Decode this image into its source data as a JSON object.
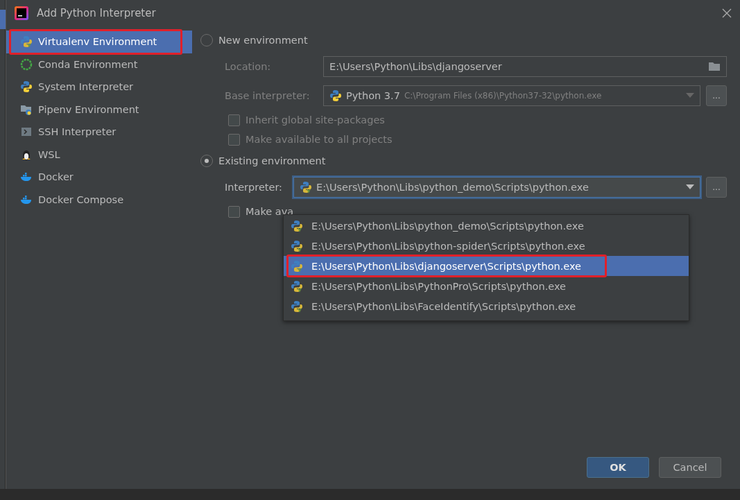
{
  "window": {
    "title": "Add Python Interpreter"
  },
  "sidebar": {
    "items": [
      {
        "label": "Virtualenv Environment",
        "kind": "virtualenv",
        "selected": true,
        "highlighted": true
      },
      {
        "label": "Conda Environment",
        "kind": "conda",
        "selected": false,
        "highlighted": false
      },
      {
        "label": "System Interpreter",
        "kind": "python",
        "selected": false,
        "highlighted": false
      },
      {
        "label": "Pipenv Environment",
        "kind": "pipenv",
        "selected": false,
        "highlighted": false
      },
      {
        "label": "SSH Interpreter",
        "kind": "ssh",
        "selected": false,
        "highlighted": false
      },
      {
        "label": "WSL",
        "kind": "wsl",
        "selected": false,
        "highlighted": false
      },
      {
        "label": "Docker",
        "kind": "docker",
        "selected": false,
        "highlighted": false
      },
      {
        "label": "Docker Compose",
        "kind": "docker",
        "selected": false,
        "highlighted": false
      }
    ]
  },
  "new_environment": {
    "label": "New environment",
    "selected": false,
    "location": {
      "label": "Location:",
      "value": "E:\\Users\\Python\\Libs\\djangoserver"
    },
    "base_interpreter": {
      "label": "Base interpreter:",
      "name": "Python 3.7",
      "path": "C:\\Program Files (x86)\\Python37-32\\python.exe",
      "more": "..."
    },
    "checkboxes": [
      {
        "label": "Inherit global site-packages",
        "checked": false
      },
      {
        "label": "Make available to all projects",
        "checked": false
      }
    ]
  },
  "existing_environment": {
    "label": "Existing environment",
    "selected": true,
    "interpreter": {
      "label": "Interpreter:",
      "value": "E:\\Users\\Python\\Libs\\python_demo\\Scripts\\python.exe",
      "more": "...",
      "expanded": true
    },
    "checkbox": {
      "label": "Make ava",
      "checked": false
    },
    "options": [
      {
        "label": "E:\\Users\\Python\\Libs\\python_demo\\Scripts\\python.exe",
        "selected": false,
        "highlighted": false
      },
      {
        "label": "E:\\Users\\Python\\Libs\\python-spider\\Scripts\\python.exe",
        "selected": false,
        "highlighted": false
      },
      {
        "label": "E:\\Users\\Python\\Libs\\djangoserver\\Scripts\\python.exe",
        "selected": true,
        "highlighted": true
      },
      {
        "label": "E:\\Users\\Python\\Libs\\PythonPro\\Scripts\\python.exe",
        "selected": false,
        "highlighted": false
      },
      {
        "label": "E:\\Users\\Python\\Libs\\FaceIdentify\\Scripts\\python.exe",
        "selected": false,
        "highlighted": false
      }
    ]
  },
  "buttons": [
    {
      "label": "OK",
      "kind": "primary"
    },
    {
      "label": "Cancel",
      "kind": "secondary"
    }
  ]
}
